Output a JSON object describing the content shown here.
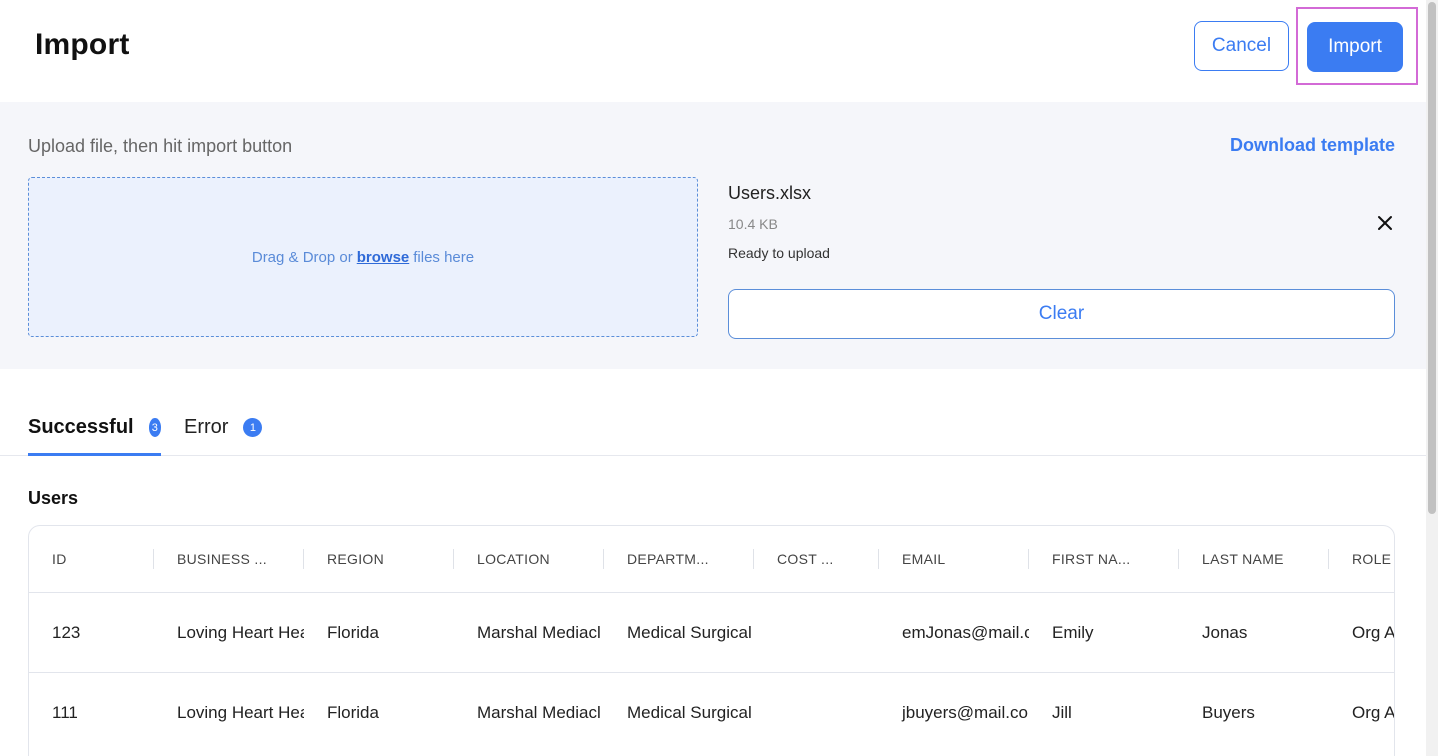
{
  "header": {
    "title": "Import",
    "cancel_label": "Cancel",
    "import_label": "Import"
  },
  "upload": {
    "hint": "Upload file, then hit import button",
    "download_template": "Download template",
    "dropzone_prefix": "Drag & Drop or",
    "dropzone_link": "browse",
    "dropzone_suffix": "files here",
    "file": {
      "name": "Users.xlsx",
      "size": "10.4 KB",
      "status": "Ready to upload"
    },
    "clear_label": "Clear"
  },
  "tabs": [
    {
      "label": "Successful",
      "count": "3",
      "active": true
    },
    {
      "label": "Error",
      "count": "1",
      "active": false
    }
  ],
  "section_title": "Users",
  "table": {
    "columns": [
      "ID",
      "BUSINESS ...",
      "REGION",
      "LOCATION",
      "DEPARTM...",
      "COST ...",
      "EMAIL",
      "FIRST NA...",
      "LAST NAME",
      "ROLE I"
    ],
    "rows": [
      [
        "123",
        "Loving Heart Hea",
        "Florida",
        "Marshal Mediacl",
        "Medical Surgical",
        "",
        "emJonas@mail.c",
        "Emily",
        "Jonas",
        "Org A"
      ],
      [
        "111",
        "Loving Heart Hea",
        "Florida",
        "Marshal Mediacl",
        "Medical Surgical",
        "",
        "jbuyers@mail.co",
        "Jill",
        "Buyers",
        "Org A"
      ]
    ]
  },
  "colors": {
    "accent": "#3b7cf2",
    "highlight": "#d36ad6",
    "panel_bg": "#f5f6fa",
    "dropzone_bg": "#ebf1fd"
  },
  "icons": {
    "remove_file": "close-icon"
  }
}
